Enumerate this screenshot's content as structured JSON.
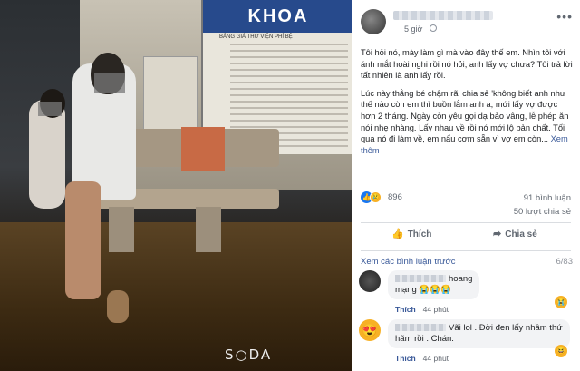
{
  "photo": {
    "board_header": "KHOA",
    "board_subtitle": "BẢNG GIÁ THƯ VIỆN PHÍ BỆ",
    "watermark": "S○DA"
  },
  "post": {
    "time": "5 giờ",
    "paragraph1": "Tôi hỏi nó, mày làm gì mà vào đây thế em. Nhìn tôi với ánh mắt hoài nghi rồi nó hỏi, anh lấy vợ chưa? Tôi trả lời tất nhiên là anh lấy rồi.",
    "paragraph2": "Lúc này thằng bé chậm rãi chia sẻ 'không biết anh như thế nào còn em thì buồn lắm anh a, mới lấy vợ được hơn 2 tháng. Ngày còn yêu gọi dạ bảo vâng, lễ phép ăn nói nhẹ nhàng. Lấy nhau về rồi nó mới lộ bản chất. Tối qua nó đi làm về, em nấu cơm sẵn vì vợ em còn...",
    "see_more": "Xem thêm",
    "reaction_count": "896",
    "comments_count": "91 bình luận",
    "shares_count": "50 lượt chia sẻ",
    "like_label": "Thích",
    "share_label": "Chia sẻ"
  },
  "comments_section": {
    "previous_label": "Xem các bình luận trước",
    "page_indicator": "6/83",
    "items": [
      {
        "text_a": "hoang",
        "text_b": "mạng 😭😭😭",
        "like_label": "Thích",
        "time": "44 phút",
        "reaction": "😭"
      },
      {
        "text_a": "Vãi lol . Đời đen lấy nhầm thứ",
        "text_b": "hãm rồi . Chán.",
        "like_label": "Thích",
        "time": "44 phút",
        "reaction": "😆"
      }
    ]
  },
  "icons": {
    "like": "thumbs-up-icon",
    "share": "share-arrow-icon",
    "globe": "globe-icon",
    "more": "more-dots-icon"
  },
  "colors": {
    "link": "#385898",
    "like_blue": "#1877f2",
    "text": "#1c1e21",
    "muted": "#606770"
  }
}
